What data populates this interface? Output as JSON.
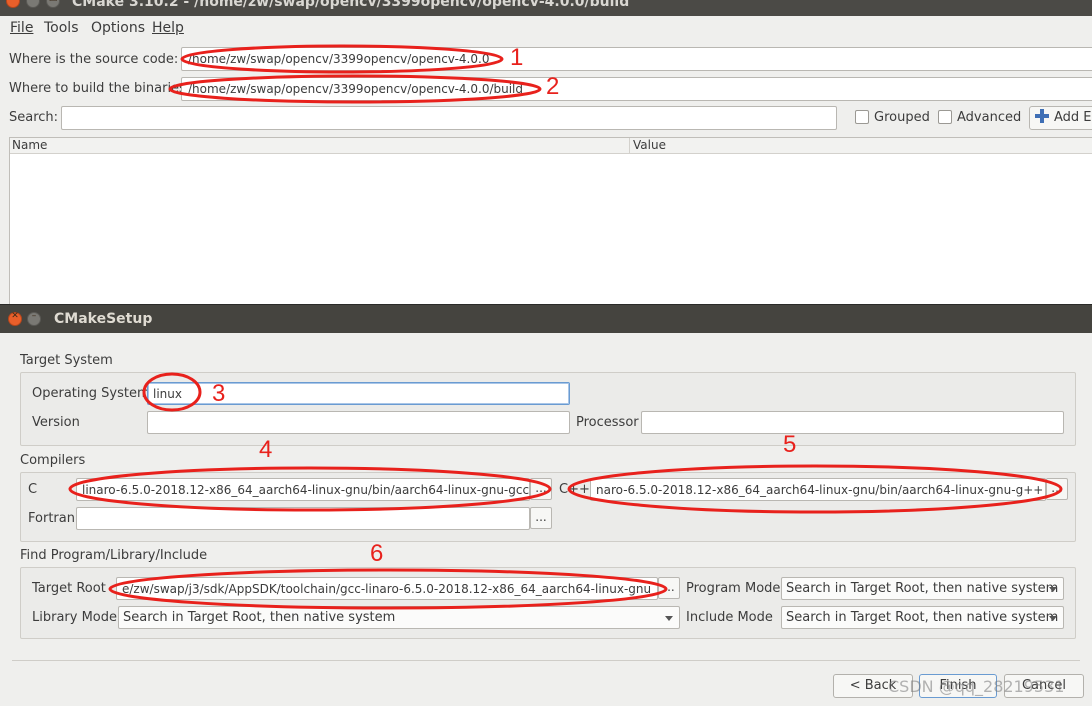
{
  "window": {
    "title": "CMake 3.10.2 - /home/zw/swap/opencv/3399opencv/opencv-4.0.0/build"
  },
  "menu": [
    "File",
    "Tools",
    "Options",
    "Help"
  ],
  "main": {
    "source_label": "Where is the source code:",
    "source_value": "/home/zw/swap/opencv/3399opencv/opencv-4.0.0",
    "build_label": "Where to build the binaries:",
    "build_value": "/home/zw/swap/opencv/3399opencv/opencv-4.0.0/build",
    "search_label": "Search:",
    "search_value": "",
    "grouped_label": "Grouped",
    "grouped_checked": false,
    "advanced_label": "Advanced",
    "advanced_checked": false,
    "add_entry_label": "Add Er",
    "table_headers": [
      "Name",
      "Value"
    ]
  },
  "dialog": {
    "title": "CMakeSetup",
    "target_system": {
      "group_label": "Target System",
      "os_label": "Operating System",
      "os_value": "linux",
      "version_label": "Version",
      "version_value": "",
      "processor_label": "Processor",
      "processor_value": ""
    },
    "compilers": {
      "group_label": "Compilers",
      "c_label": "C",
      "c_value": "linaro-6.5.0-2018.12-x86_64_aarch64-linux-gnu/bin/aarch64-linux-gnu-gcc",
      "cxx_label": "C++",
      "cxx_value": "naro-6.5.0-2018.12-x86_64_aarch64-linux-gnu/bin/aarch64-linux-gnu-g++",
      "fortran_label": "Fortran",
      "fortran_value": "",
      "browse_label": "..."
    },
    "find": {
      "group_label": "Find Program/Library/Include",
      "target_root_label": "Target Root",
      "target_root_value": "e/zw/swap/j3/sdk/AppSDK/toolchain/gcc-linaro-6.5.0-2018.12-x86_64_aarch64-linux-gnu",
      "program_mode_label": "Program Mode",
      "program_mode_value": "Search in Target Root, then native system",
      "library_mode_label": "Library Mode",
      "library_mode_value": "Search in Target Root, then native system",
      "include_mode_label": "Include Mode",
      "include_mode_value": "Search in Target Root, then native system"
    },
    "buttons": {
      "back": "< Back",
      "finish": "Finish",
      "cancel": "Cancel"
    }
  },
  "annotations": [
    "1",
    "2",
    "3",
    "4",
    "5",
    "6"
  ],
  "watermark": "CSDN @qq_28219531",
  "colors": {
    "annotation_red": "#e8211c",
    "titlebar": "#4b4a46",
    "close_button": "#e95f2a"
  }
}
